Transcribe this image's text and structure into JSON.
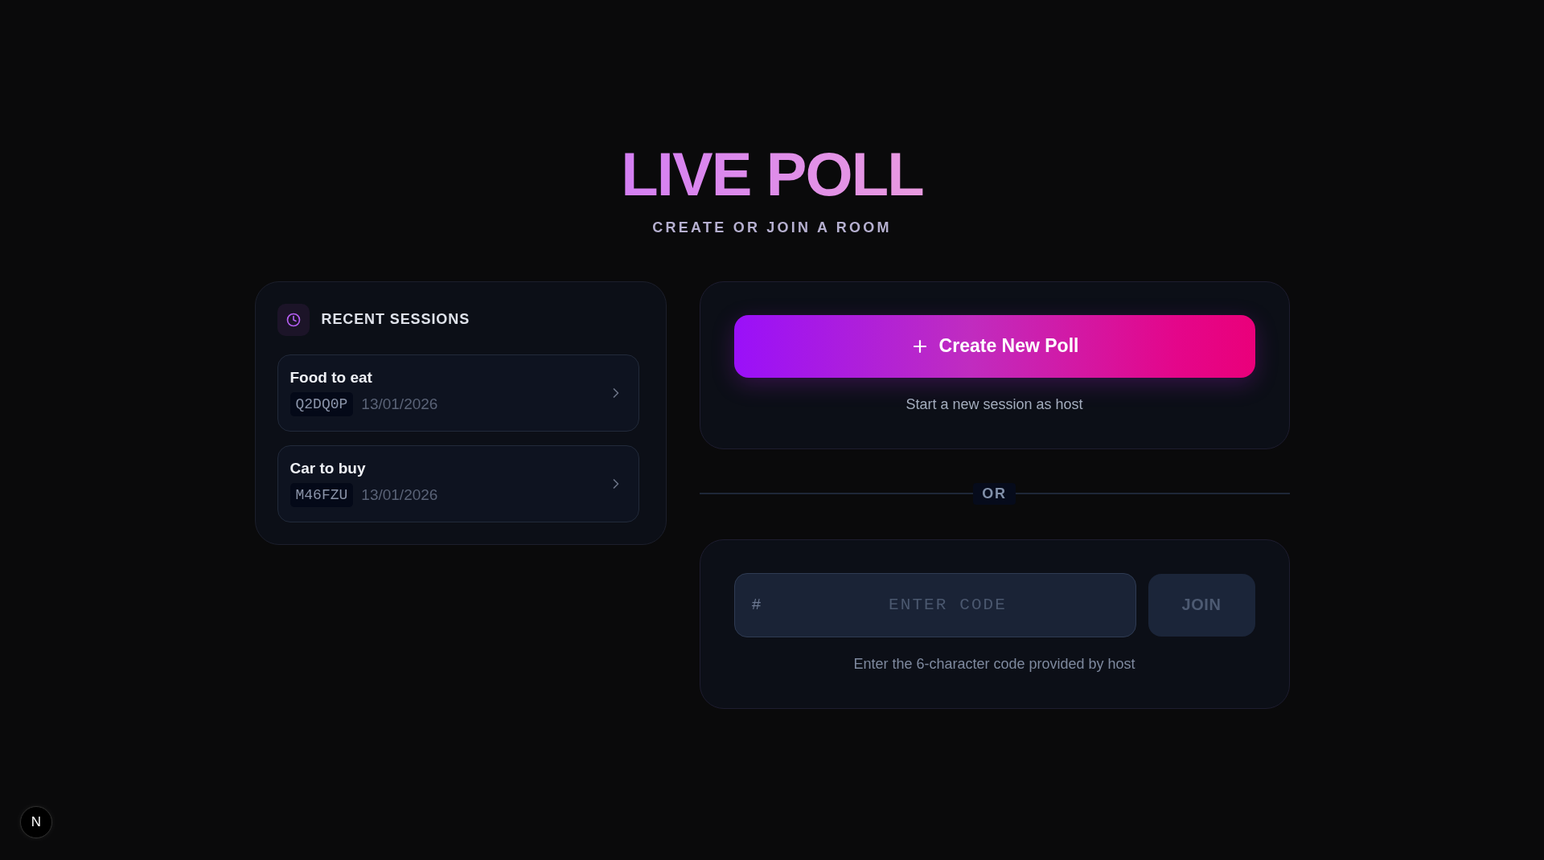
{
  "header": {
    "title": "LIVE POLL",
    "subtitle": "CREATE OR JOIN A ROOM"
  },
  "recent_sessions": {
    "title": "RECENT SESSIONS",
    "items": [
      {
        "name": "Food to eat",
        "code": "Q2DQ0P",
        "date": "13/01/2026"
      },
      {
        "name": "Car to buy",
        "code": "M46FZU",
        "date": "13/01/2026"
      }
    ]
  },
  "create": {
    "button": "Create New Poll",
    "hint": "Start a new session as host"
  },
  "divider": {
    "label": "OR"
  },
  "join": {
    "prefix": "#",
    "placeholder": "ENTER CODE",
    "button": {
      "label": "JOIN",
      "disabled": true
    },
    "hint": "Enter the 6-character code provided by host"
  },
  "dev_indicator": {
    "label": "N"
  }
}
